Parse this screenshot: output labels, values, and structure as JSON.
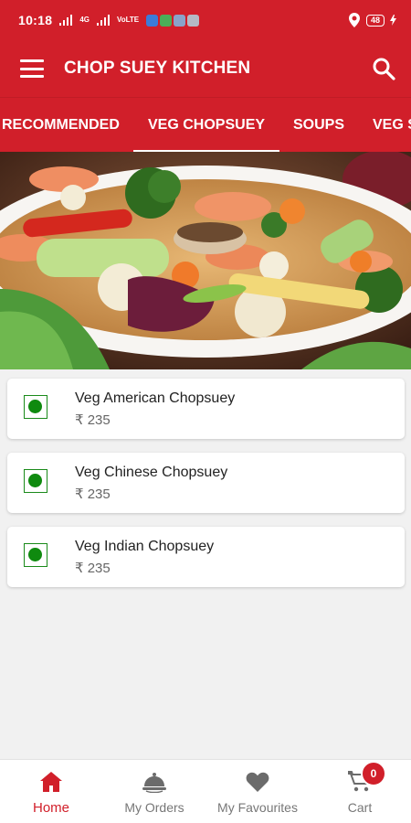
{
  "status_bar": {
    "time": "10:18",
    "network": "4G",
    "volte": "VoLTE",
    "battery": "48"
  },
  "app_bar": {
    "title": "CHOP SUEY KITCHEN",
    "menu_icon": "menu-icon",
    "search_icon": "search-icon"
  },
  "tabs": [
    {
      "label": "RECOMMENDED",
      "active": false
    },
    {
      "label": "VEG CHOPSUEY",
      "active": true
    },
    {
      "label": "SOUPS",
      "active": false
    },
    {
      "label": "VEG S",
      "active": false
    }
  ],
  "banner": {
    "image": "vegetable chopsuey dish"
  },
  "items": [
    {
      "name": "Veg American Chopsuey",
      "price": "₹ 235",
      "veg": true
    },
    {
      "name": "Veg Chinese Chopsuey",
      "price": "₹ 235",
      "veg": true
    },
    {
      "name": "Veg Indian Chopsuey",
      "price": "₹ 235",
      "veg": true
    }
  ],
  "bottom_nav": [
    {
      "label": "Home",
      "icon": "home-icon",
      "active": true
    },
    {
      "label": "My Orders",
      "icon": "cloche-icon",
      "active": false
    },
    {
      "label": "My Favourites",
      "icon": "heart-icon",
      "active": false
    },
    {
      "label": "Cart",
      "icon": "cart-icon",
      "active": false,
      "badge": "0"
    }
  ],
  "colors": {
    "primary": "#d11f2a",
    "veg_green": "#0f8a0f",
    "background": "#f1f1f1"
  }
}
